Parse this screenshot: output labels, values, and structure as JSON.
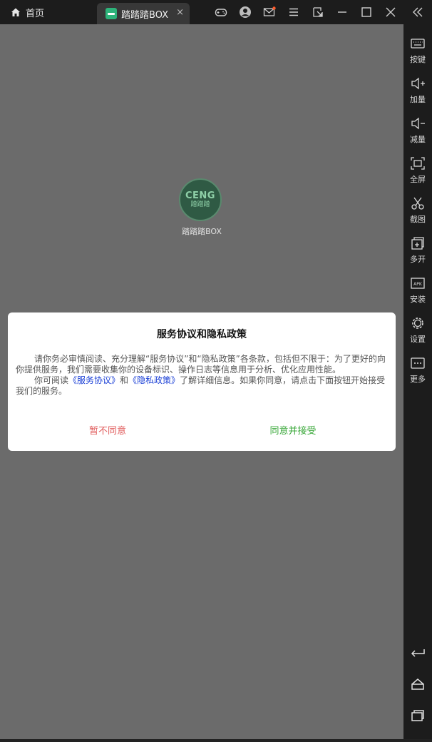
{
  "titlebar": {
    "home_label": "首页",
    "app_tab_label": "踏踏踏BOX",
    "close_tab_glyph": "×"
  },
  "app_icon": {
    "logo_line1": "CENG",
    "logo_line2": "蹭蹭蹭",
    "label": "踏踏踏BOX"
  },
  "dialog": {
    "title": "服务协议和隐私政策",
    "para1": "请你务必审慎阅读、充分理解“服务协议”和“隐私政策”各条款，包括但不限于：为了更好的向你提供服务，我们需要收集你的设备标识、操作日志等信息用于分析、优化应用性能。",
    "para2_prefix": "你可阅读",
    "link_service": "《服务协议》",
    "para2_and": "和",
    "link_privacy": "《隐私政策》",
    "para2_suffix": "了解详细信息。如果你同意，请点击下面按钮开始接受我们的服务。",
    "reject_label": "暂不同意",
    "accept_label": "同意并接受"
  },
  "sidebar": {
    "keys_label": "按键",
    "vol_up_label": "加量",
    "vol_down_label": "减量",
    "fullscreen_label": "全屏",
    "screenshot_label": "截图",
    "multi_label": "多开",
    "install_label": "安装",
    "settings_label": "设置",
    "more_label": "更多"
  },
  "colors": {
    "accept": "#3aa83a",
    "reject": "#e05a5a",
    "link": "#1a3fd6",
    "notification_dot": "#ff5a2a"
  }
}
